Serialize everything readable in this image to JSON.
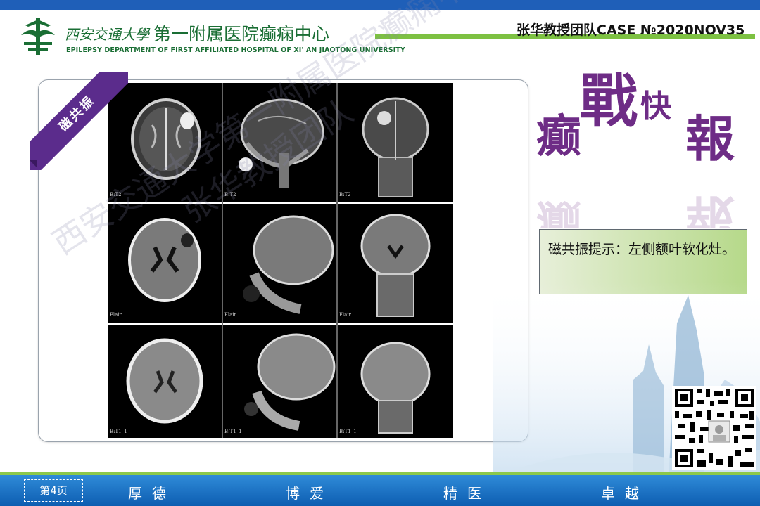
{
  "header": {
    "university": "西安交通大學",
    "department": "第一附属医院癫痫中心",
    "department_en": "EPILEPSY DEPARTMENT OF FIRST AFFILIATED HOSPITAL OF XI' AN JIAOTONG UNIVERSITY",
    "case_id": "张华教授团队CASE №2020NOV35"
  },
  "colors": {
    "brand_green": "#1a6e34",
    "ribbon_purple": "#5b2c8c",
    "footer_blue": "#0d5db1",
    "accent_green": "#7dc142"
  },
  "watermark": {
    "line1": "西安交通大学第一附属医院癫痫中心",
    "line2": "张华教授团队"
  },
  "mri": {
    "ribbon_label": "磁共振",
    "images": [
      {
        "sequence": "B:T2",
        "view": "axial"
      },
      {
        "sequence": "B:T2",
        "view": "sagittal"
      },
      {
        "sequence": "B:T2",
        "view": "coronal"
      },
      {
        "sequence": "Flair",
        "view": "axial"
      },
      {
        "sequence": "Flair",
        "view": "sagittal"
      },
      {
        "sequence": "Flair",
        "view": "coronal"
      },
      {
        "sequence": "B:T1_1",
        "view": "axial"
      },
      {
        "sequence": "B:T1_1",
        "view": "sagittal"
      },
      {
        "sequence": "B:T1_1",
        "view": "coronal"
      }
    ]
  },
  "title_art": {
    "chars": [
      "癫",
      "戰",
      "快",
      "報"
    ]
  },
  "finding": {
    "text": "磁共振提示：左侧额叶软化灶。"
  },
  "footer": {
    "page_label": "第4页",
    "mottos": [
      "厚德",
      "博爱",
      "精医",
      "卓越"
    ]
  }
}
